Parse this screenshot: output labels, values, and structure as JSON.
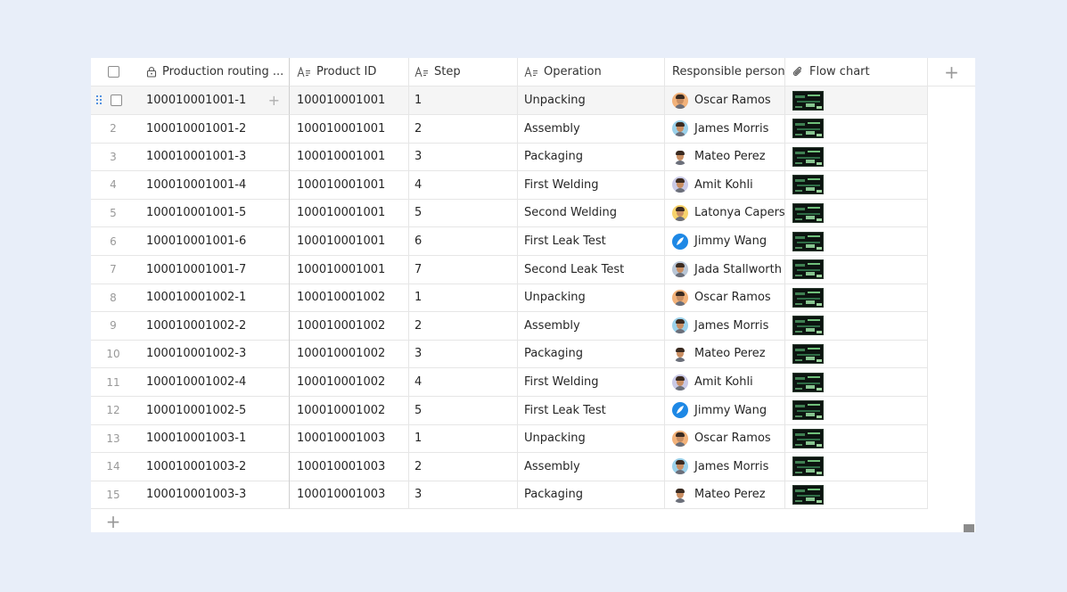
{
  "columns": {
    "production_routing": "Production routing ...",
    "product_id": "Product ID",
    "step": "Step",
    "operation": "Operation",
    "responsible_person": "Responsible person",
    "flow_chart": "Flow chart",
    "add_column": "+"
  },
  "add_row": "+",
  "people_colors": {
    "Oscar Ramos": "#f2b27a",
    "James Morris": "#9bd1ea",
    "Mateo Perez": "#ffffff",
    "Amit Kohli": "#c9c9e6",
    "Latonya Capers": "#f7d36b",
    "Jimmy Wang": "#1e88e5",
    "Jada Stallworth": "#b9c6d6"
  },
  "rows": [
    {
      "num": "",
      "routing": "100010001001-1",
      "product_id": "100010001001",
      "step": "1",
      "operation": "Unpacking",
      "person": "Oscar Ramos"
    },
    {
      "num": "2",
      "routing": "100010001001-2",
      "product_id": "100010001001",
      "step": "2",
      "operation": "Assembly",
      "person": "James Morris"
    },
    {
      "num": "3",
      "routing": "100010001001-3",
      "product_id": "100010001001",
      "step": "3",
      "operation": "Packaging",
      "person": "Mateo Perez"
    },
    {
      "num": "4",
      "routing": "100010001001-4",
      "product_id": "100010001001",
      "step": "4",
      "operation": "First Welding",
      "person": "Amit Kohli"
    },
    {
      "num": "5",
      "routing": "100010001001-5",
      "product_id": "100010001001",
      "step": "5",
      "operation": "Second Welding",
      "person": "Latonya Capers"
    },
    {
      "num": "6",
      "routing": "100010001001-6",
      "product_id": "100010001001",
      "step": "6",
      "operation": "First Leak Test",
      "person": "Jimmy Wang"
    },
    {
      "num": "7",
      "routing": "100010001001-7",
      "product_id": "100010001001",
      "step": "7",
      "operation": "Second Leak Test",
      "person": "Jada Stallworth"
    },
    {
      "num": "8",
      "routing": "100010001002-1",
      "product_id": "100010001002",
      "step": "1",
      "operation": "Unpacking",
      "person": "Oscar Ramos"
    },
    {
      "num": "9",
      "routing": "100010001002-2",
      "product_id": "100010001002",
      "step": "2",
      "operation": "Assembly",
      "person": "James Morris"
    },
    {
      "num": "10",
      "routing": "100010001002-3",
      "product_id": "100010001002",
      "step": "3",
      "operation": "Packaging",
      "person": "Mateo Perez"
    },
    {
      "num": "11",
      "routing": "100010001002-4",
      "product_id": "100010001002",
      "step": "4",
      "operation": "First Welding",
      "person": "Amit Kohli"
    },
    {
      "num": "12",
      "routing": "100010001002-5",
      "product_id": "100010001002",
      "step": "5",
      "operation": "First Leak Test",
      "person": "Jimmy Wang"
    },
    {
      "num": "13",
      "routing": "100010001003-1",
      "product_id": "100010001003",
      "step": "1",
      "operation": "Unpacking",
      "person": "Oscar Ramos"
    },
    {
      "num": "14",
      "routing": "100010001003-2",
      "product_id": "100010001003",
      "step": "2",
      "operation": "Assembly",
      "person": "James Morris"
    },
    {
      "num": "15",
      "routing": "100010001003-3",
      "product_id": "100010001003",
      "step": "3",
      "operation": "Packaging",
      "person": "Mateo Perez"
    }
  ]
}
